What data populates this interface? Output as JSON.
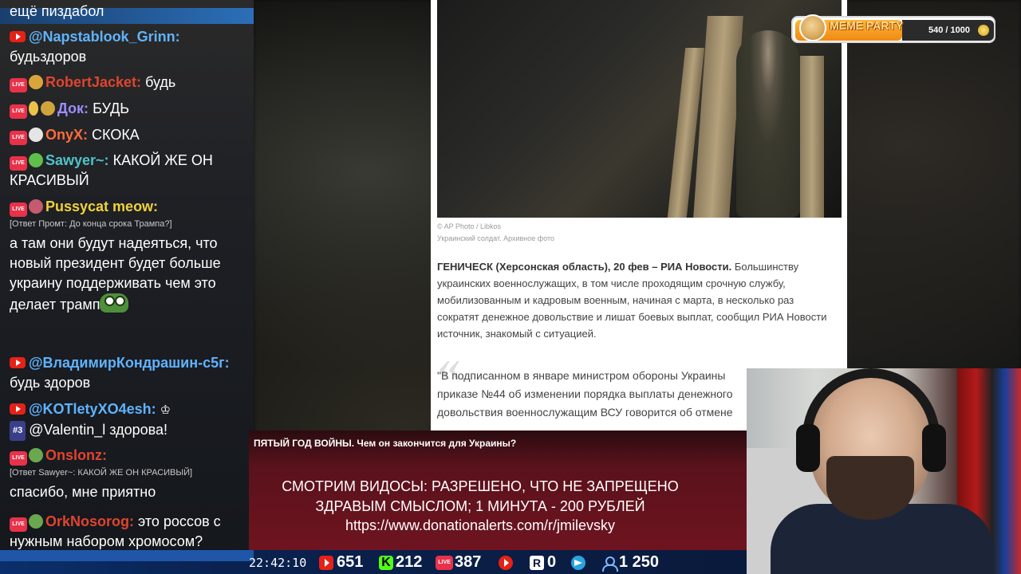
{
  "chat": {
    "messages": [
      {
        "text": "ещё пиздабол"
      },
      {
        "nick": "@Napstablook_Grinn:",
        "nick_color": "#5fb3ff",
        "text": "будьздоров"
      },
      {
        "nick": "RobertJacket:",
        "nick_color": "#e0442f",
        "text": "будь"
      },
      {
        "nick": "Док:",
        "nick_color": "#9d8cff",
        "text": "БУДЬ"
      },
      {
        "nick": "OnyX:",
        "nick_color": "#ff6a3d",
        "text": "СКОКА"
      },
      {
        "nick": "Sawyer~:",
        "nick_color": "#4fc3c9",
        "text": "КАКОЙ ЖЕ ОН КРАСИВЫЙ"
      },
      {
        "nick": "Pussycat meow:",
        "nick_color": "#f0d23a",
        "reply": "[Ответ Промт: До конца срока Трампа?]",
        "text": "а там они будут надеяться, что новый президент будет больше украину поддерживать чем это делает трамп"
      },
      {
        "nick": "@ВладимирКондрашин-с5г:",
        "nick_color": "#5fb3ff",
        "text": "будь здоров"
      },
      {
        "nick": "@KOTletyXO4esh:",
        "nick_color": "#5fb3ff",
        "rank": "#3",
        "text": "@Valentin_l здорова!"
      },
      {
        "nick": "Onslonz:",
        "nick_color": "#e0442f",
        "reply": "[Ответ Sawyer~: КАКОЙ ЖЕ ОН КРАСИВЫЙ]",
        "text": "спасибо, мне приятно"
      },
      {
        "nick": "OrkNosorog:",
        "nick_color": "#e0442f",
        "text": "это россов с нужным набором хромосом?"
      }
    ]
  },
  "article": {
    "photo_credit": "© AP Photo / Libkos",
    "photo_caption": "Украинский солдат. Архивное фото",
    "lead_bold": "ГЕНИЧЕСК (Херсонская область), 20 фев – РИА Новости.",
    "lead_text": " Большинству украинских военнослужащих, в том числе проходящим срочную службу, мобилизованным и кадровым военным, начиная с марта, в несколько раз сократят денежное довольствие и лишат боевых выплат, сообщил РИА Новости источник, знакомый с ситуацией.",
    "quote_mark": "«",
    "quote_line1": "\"В подписанном в январе министром обороны Украины",
    "quote_line2": "приказе №44 об изменении порядка выплаты денежного",
    "quote_line3": "довольствия военнослужащим ВСУ говорится об отмене"
  },
  "banner": {
    "video_title": "ПЯТЫЙ ГОД ВОЙНЫ. Чем он закончится для Украины?",
    "donate_line1": "СМОТРИМ ВИДОСЫ: РАЗРЕШЕНО, ЧТО НЕ ЗАПРЕЩЕНО",
    "donate_line2": "ЗДРАВЫМ СМЫСЛОМ; 1 МИНУТА - 200 РУБЛЕЙ",
    "donate_line3": "https://www.donationalerts.com/r/jmilevsky"
  },
  "meme_party": {
    "title": "MEME PARTY",
    "count": "540 / 1000",
    "progress": 0.54
  },
  "stats": {
    "clock": "22:42:10",
    "youtube_viewers": "651",
    "kick_viewers": "212",
    "vk_live_viewers": "387",
    "rutube_viewers": "0",
    "total_viewers": "1 250"
  },
  "icons": {
    "youtube": "youtube-icon",
    "kick": "kick-icon",
    "vk_live": "vk-live-icon",
    "rutube": "rutube-icon",
    "telegram": "telegram-icon",
    "viewers": "user-icon"
  },
  "colors": {
    "youtube_red": "#e62117",
    "kick_green": "#53fc18",
    "live_red": "#e8324a",
    "banner_red": "#6e1420",
    "stats_blue": "#0b2f6b"
  }
}
